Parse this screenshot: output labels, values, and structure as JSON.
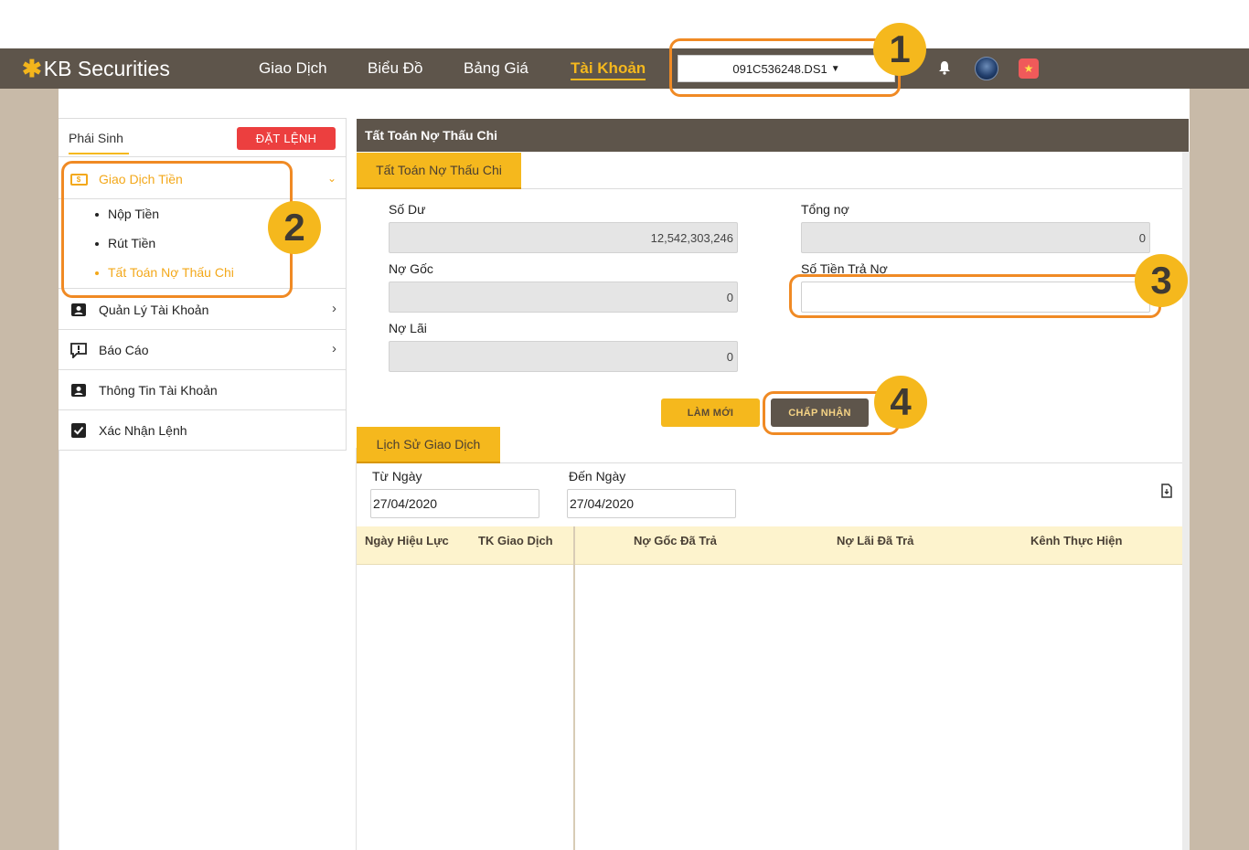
{
  "header": {
    "brand": "KB Securities",
    "brand_mark": "✱",
    "nav": [
      {
        "label": "Giao Dịch"
      },
      {
        "label": "Biểu Đồ"
      },
      {
        "label": "Bảng Giá"
      },
      {
        "label": "Tài Khoản",
        "active": true
      }
    ],
    "account": "091C536248.DS1",
    "icons": [
      "bell-icon",
      "avatar",
      "vietnam-flag-icon"
    ]
  },
  "sidebar": {
    "title": "Phái Sinh",
    "order_button": "ĐẶT LỆNH",
    "groups": [
      {
        "label": "Giao Dịch Tiền",
        "icon": "money-icon",
        "expanded": true,
        "items": [
          {
            "label": "Nộp Tiền"
          },
          {
            "label": "Rút Tiền"
          },
          {
            "label": "Tất Toán Nợ Thấu Chi",
            "active": true
          }
        ]
      },
      {
        "label": "Quản Lý Tài Khoản",
        "icon": "user-card-icon"
      },
      {
        "label": "Báo Cáo",
        "icon": "report-icon"
      },
      {
        "label": "Thông Tin Tài Khoản",
        "icon": "account-info-icon"
      },
      {
        "label": "Xác Nhận Lệnh",
        "icon": "checkbox-icon"
      }
    ]
  },
  "main": {
    "panel_title": "Tất Toán Nợ Thấu Chi",
    "tab": "Tất Toán Nợ Thấu Chi",
    "fields": {
      "so_du": {
        "label": "Số Dư",
        "value": "12,542,303,246"
      },
      "tong_no": {
        "label": "Tổng nợ",
        "value": "0"
      },
      "no_goc": {
        "label": "Nợ Gốc",
        "value": "0"
      },
      "so_tien_tra_no": {
        "label": "Số Tiền Trả Nợ",
        "value": ""
      },
      "no_lai": {
        "label": "Nợ Lãi",
        "value": "0"
      }
    },
    "buttons": {
      "refresh": "LÀM MỚI",
      "accept": "CHẤP NHẬN"
    },
    "history": {
      "tab": "Lịch Sử Giao Dịch",
      "from_label": "Từ Ngày",
      "from_value": "27/04/2020",
      "to_label": "Đến Ngày",
      "to_value": "27/04/2020",
      "columns": [
        "Ngày Hiệu Lực",
        "TK Giao Dịch",
        "Nợ Gốc Đã Trả",
        "Nợ Lãi Đã Trả",
        "Kênh Thực Hiện"
      ],
      "rows": []
    }
  },
  "annotations": [
    {
      "label": "1"
    },
    {
      "label": "2"
    },
    {
      "label": "3"
    },
    {
      "label": "4"
    }
  ],
  "colors": {
    "topbar": "#5e554b",
    "accent": "#f5b81d",
    "callout": "#f08a24",
    "order_red": "#ec3f3f"
  }
}
